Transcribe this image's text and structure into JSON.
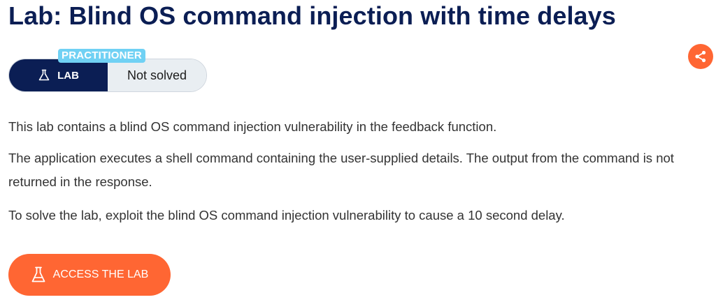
{
  "page": {
    "title": "Lab: Blind OS command injection with time delays"
  },
  "lab_status": {
    "level": "PRACTITIONER",
    "type_label": "LAB",
    "status": "Not solved"
  },
  "description": {
    "paragraph_1": "This lab contains a blind OS command injection vulnerability in the feedback function.",
    "paragraph_2": "The application executes a shell command containing the user-supplied details. The output from the command is not returned in the response.",
    "paragraph_3": "To solve the lab, exploit the blind OS command injection vulnerability to cause a 10 second delay."
  },
  "actions": {
    "access_label": "ACCESS THE LAB"
  },
  "icons": {
    "share": "share-icon",
    "flask": "flask-icon"
  },
  "colors": {
    "title": "#0b1e54",
    "accent": "#ff6633",
    "badge": "#70d1f4",
    "pill_dark": "#0b1e54",
    "pill_light": "#e9eef2"
  }
}
